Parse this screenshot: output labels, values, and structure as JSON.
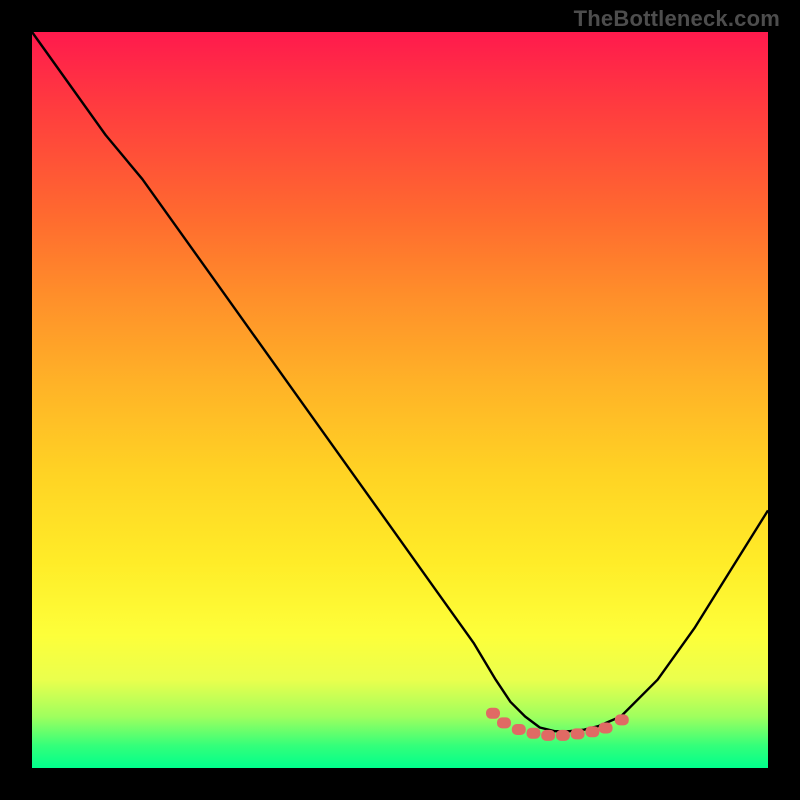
{
  "watermark": "TheBottleneck.com",
  "chart_data": {
    "type": "line",
    "title": "",
    "xlabel": "",
    "ylabel": "",
    "xlim": [
      0,
      100
    ],
    "ylim": [
      0,
      100
    ],
    "grid": false,
    "legend": false,
    "series": [
      {
        "name": "curve",
        "color": "#000000",
        "x": [
          0,
          5,
          10,
          15,
          20,
          25,
          30,
          35,
          40,
          45,
          50,
          55,
          60,
          63,
          65,
          67,
          69,
          71,
          73,
          75,
          77,
          80,
          85,
          90,
          95,
          100
        ],
        "values": [
          100,
          93,
          86,
          80,
          73,
          66,
          59,
          52,
          45,
          38,
          31,
          24,
          17,
          12,
          9,
          7,
          5.5,
          5,
          5,
          5.2,
          5.7,
          7,
          12,
          19,
          27,
          35
        ]
      }
    ],
    "markers": {
      "name": "dotted-cluster",
      "color": "#e06a64",
      "x": [
        62.5,
        64,
        66,
        68,
        70,
        72,
        74,
        76,
        77.8,
        80
      ],
      "values": [
        7.5,
        6.2,
        5.3,
        4.8,
        4.5,
        4.5,
        4.7,
        5.0,
        5.5,
        6.6
      ]
    },
    "background_gradient": {
      "top": "#ff1a4d",
      "mid": "#ffd324",
      "bottom": "#00ff8c"
    }
  }
}
